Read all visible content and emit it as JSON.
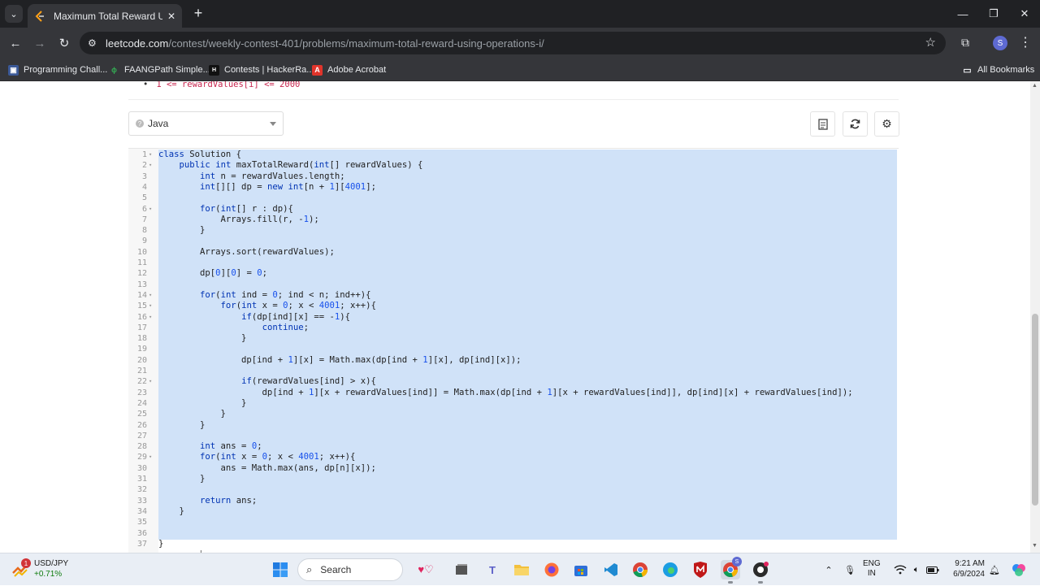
{
  "browser": {
    "tab_title": "Maximum Total Reward Using O",
    "url_host": "leetcode.com",
    "url_path": "/contest/weekly-contest-401/problems/maximum-total-reward-using-operations-i/",
    "profile_initial": "S",
    "bookmarks": [
      "Programming Chall...",
      "FAANGPath Simple...",
      "Contests | HackerRa...",
      "Adobe Acrobat"
    ],
    "all_bookmarks_label": "All Bookmarks"
  },
  "problem": {
    "constraint_text": "1 <= rewardValues[i] <= 2000"
  },
  "editor": {
    "language": "Java",
    "lines": [
      {
        "n": "1",
        "fold": true,
        "text": "class Solution {"
      },
      {
        "n": "2",
        "fold": true,
        "text": "    public int maxTotalReward(int[] rewardValues) {"
      },
      {
        "n": "3",
        "fold": false,
        "text": "        int n = rewardValues.length;"
      },
      {
        "n": "4",
        "fold": false,
        "text": "        int[][] dp = new int[n + 1][4001];"
      },
      {
        "n": "5",
        "fold": false,
        "text": ""
      },
      {
        "n": "6",
        "fold": true,
        "text": "        for(int[] r : dp){"
      },
      {
        "n": "7",
        "fold": false,
        "text": "            Arrays.fill(r, -1);"
      },
      {
        "n": "8",
        "fold": false,
        "text": "        }"
      },
      {
        "n": "9",
        "fold": false,
        "text": ""
      },
      {
        "n": "10",
        "fold": false,
        "text": "        Arrays.sort(rewardValues);"
      },
      {
        "n": "11",
        "fold": false,
        "text": ""
      },
      {
        "n": "12",
        "fold": false,
        "text": "        dp[0][0] = 0;"
      },
      {
        "n": "13",
        "fold": false,
        "text": ""
      },
      {
        "n": "14",
        "fold": true,
        "text": "        for(int ind = 0; ind < n; ind++){"
      },
      {
        "n": "15",
        "fold": true,
        "text": "            for(int x = 0; x < 4001; x++){"
      },
      {
        "n": "16",
        "fold": true,
        "text": "                if(dp[ind][x] == -1){"
      },
      {
        "n": "17",
        "fold": false,
        "text": "                    continue;"
      },
      {
        "n": "18",
        "fold": false,
        "text": "                }"
      },
      {
        "n": "19",
        "fold": false,
        "text": ""
      },
      {
        "n": "20",
        "fold": false,
        "text": "                dp[ind + 1][x] = Math.max(dp[ind + 1][x], dp[ind][x]);"
      },
      {
        "n": "21",
        "fold": false,
        "text": ""
      },
      {
        "n": "22",
        "fold": true,
        "text": "                if(rewardValues[ind] > x){"
      },
      {
        "n": "23",
        "fold": false,
        "text": "                    dp[ind + 1][x + rewardValues[ind]] = Math.max(dp[ind + 1][x + rewardValues[ind]], dp[ind][x] + rewardValues[ind]);"
      },
      {
        "n": "24",
        "fold": false,
        "text": "                }"
      },
      {
        "n": "25",
        "fold": false,
        "text": "            }"
      },
      {
        "n": "26",
        "fold": false,
        "text": "        }"
      },
      {
        "n": "27",
        "fold": false,
        "text": ""
      },
      {
        "n": "28",
        "fold": false,
        "text": "        int ans = 0;"
      },
      {
        "n": "29",
        "fold": true,
        "text": "        for(int x = 0; x < 4001; x++){"
      },
      {
        "n": "30",
        "fold": false,
        "text": "            ans = Math.max(ans, dp[n][x]);"
      },
      {
        "n": "31",
        "fold": false,
        "text": "        }"
      },
      {
        "n": "32",
        "fold": false,
        "text": ""
      },
      {
        "n": "33",
        "fold": false,
        "text": "        return ans;"
      },
      {
        "n": "34",
        "fold": false,
        "text": "    }"
      },
      {
        "n": "35",
        "fold": false,
        "text": ""
      },
      {
        "n": "36",
        "fold": false,
        "text": ""
      },
      {
        "n": "37",
        "fold": false,
        "text": "}"
      }
    ],
    "colors": {
      "selection": "#d0e2f8",
      "keyword": "#0033b3",
      "number": "#1750eb",
      "operator": "#1750eb"
    }
  },
  "taskbar": {
    "stock_name": "USD/JPY",
    "stock_change": "+0.71%",
    "stock_badge": "1",
    "search_label": "Search",
    "chrome_badge": "S",
    "lang_line1": "ENG",
    "lang_line2": "IN",
    "time": "9:21 AM",
    "date": "6/9/2024"
  }
}
